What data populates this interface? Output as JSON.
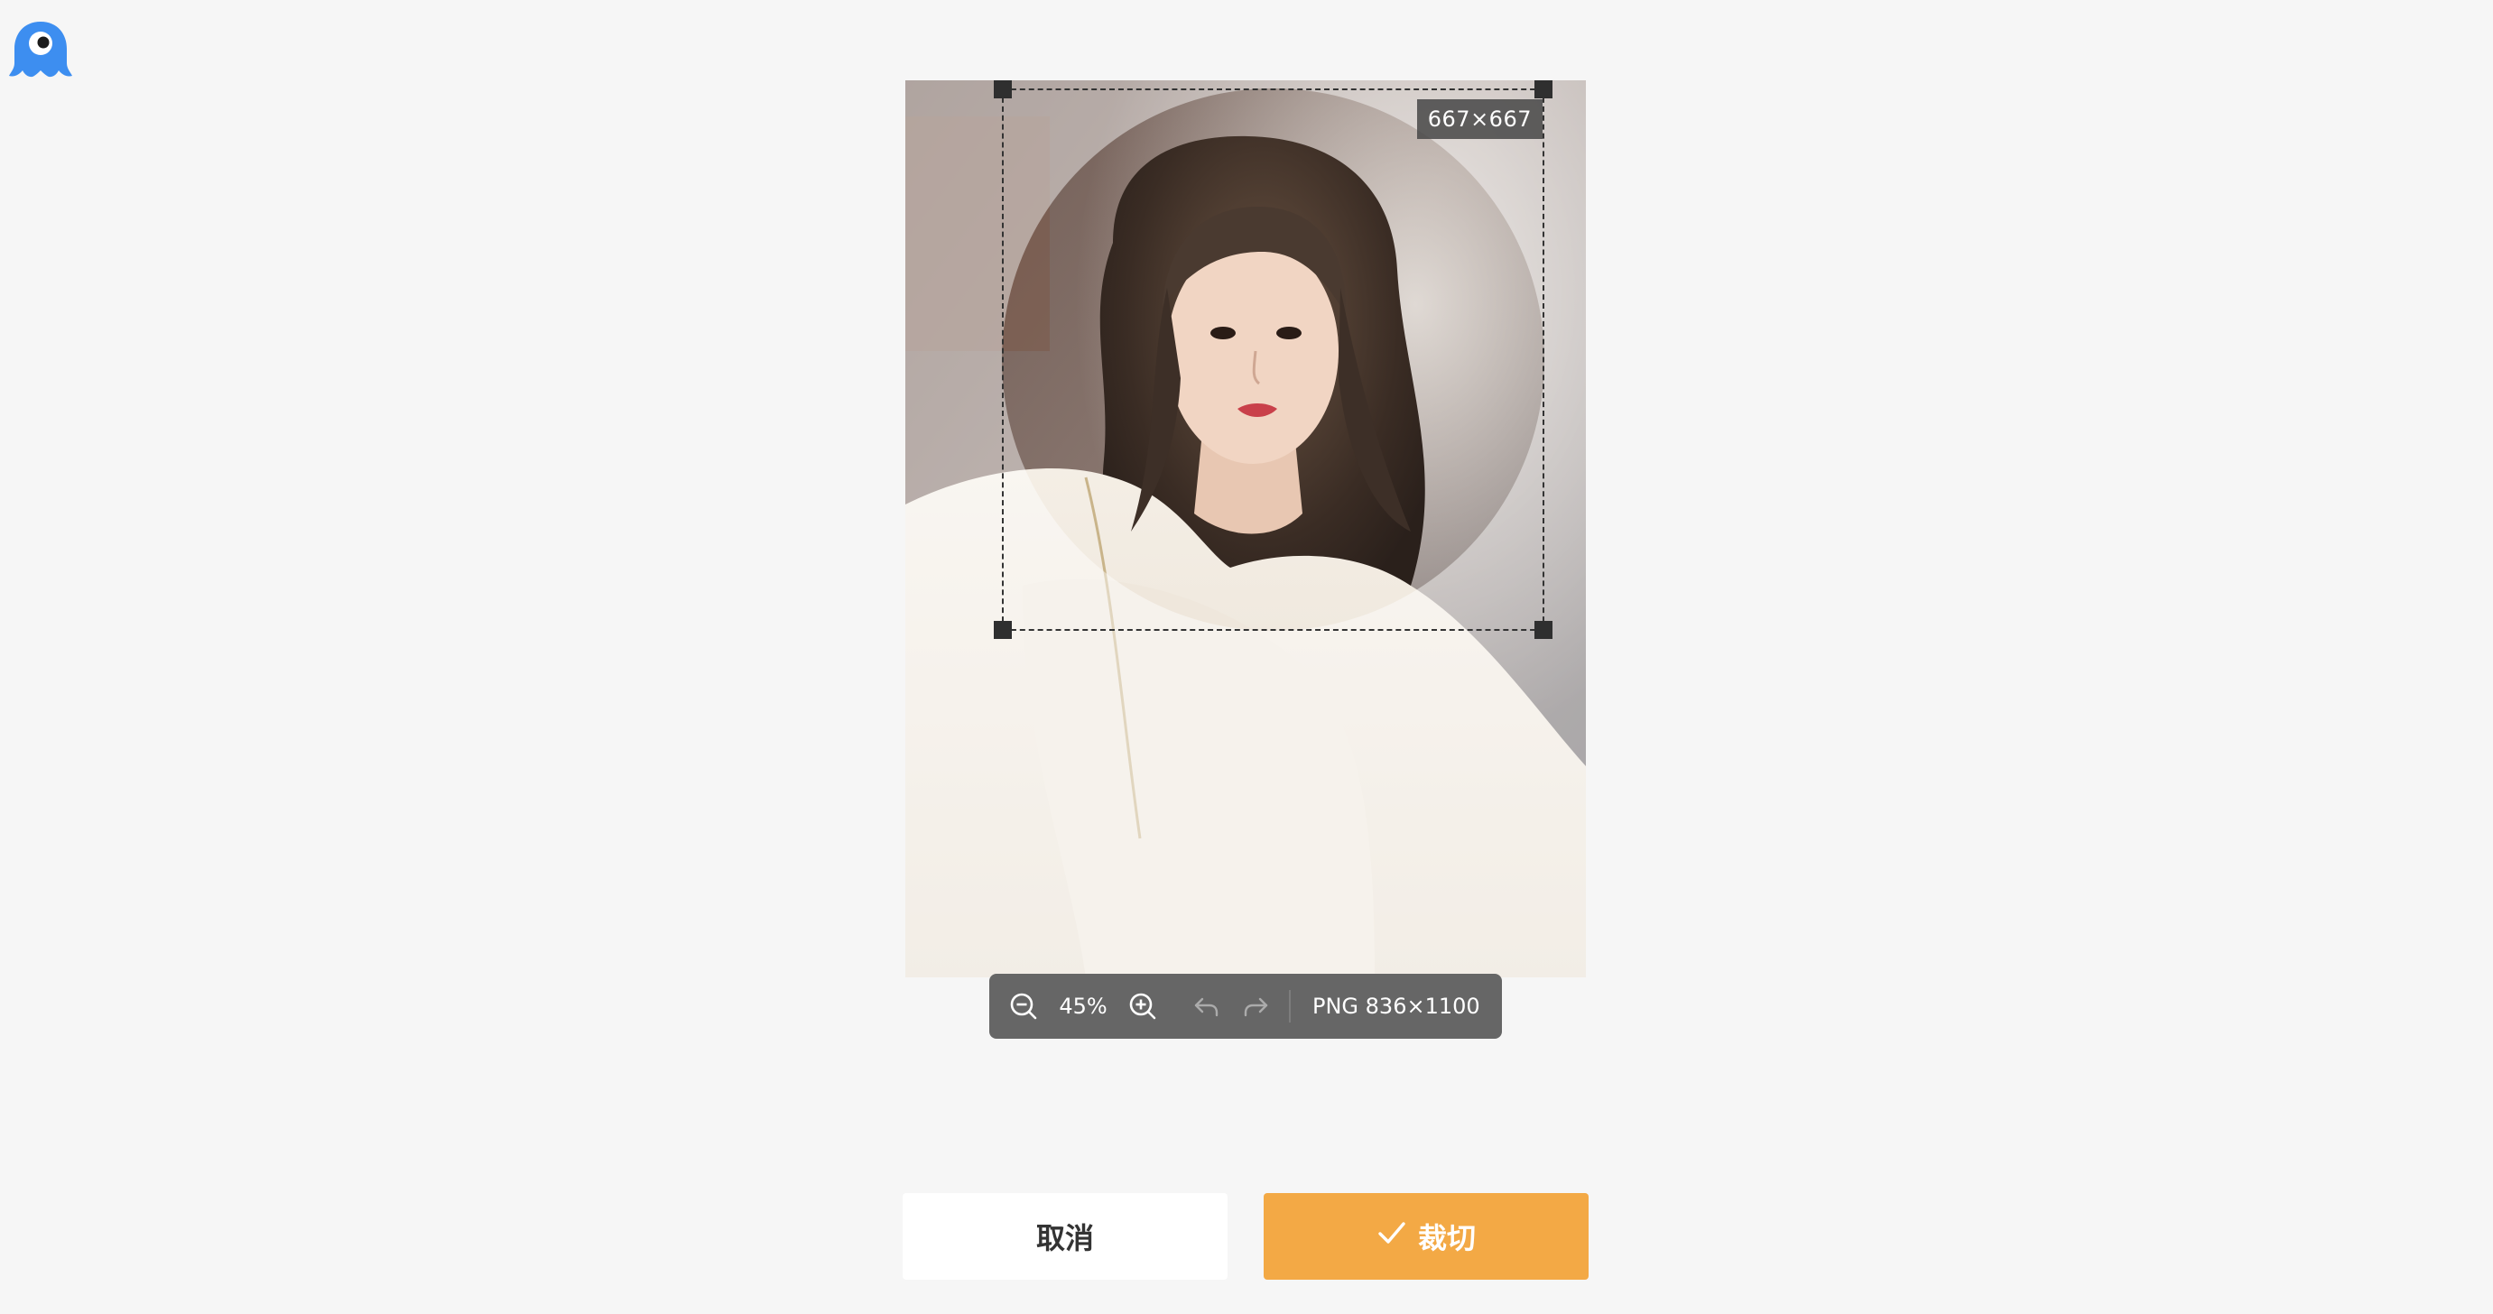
{
  "app": {
    "logo_icon": "octopus-logo-icon",
    "accent_color": "#3d8ef0"
  },
  "crop": {
    "size_label": "667×667",
    "shape": "circle"
  },
  "toolbar": {
    "zoom_out_icon": "zoom-out-icon",
    "zoom_value": "45%",
    "zoom_in_icon": "zoom-in-icon",
    "undo_icon": "undo-icon",
    "redo_icon": "redo-icon",
    "file_info": "PNG 836×1100"
  },
  "actions": {
    "cancel_label": "取消",
    "confirm_label": "裁切",
    "confirm_icon": "checkmark-icon",
    "confirm_color": "#f3a945"
  }
}
